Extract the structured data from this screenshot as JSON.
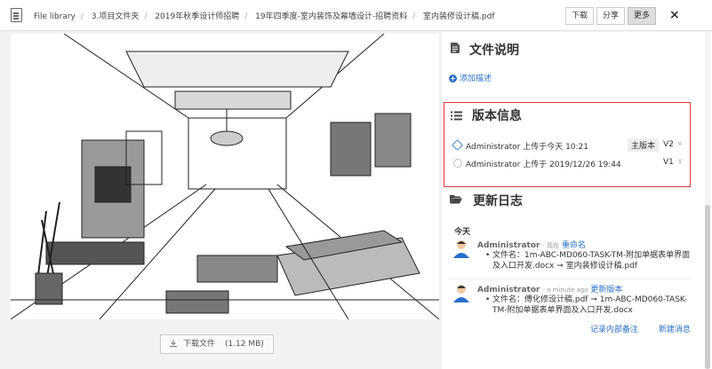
{
  "breadcrumbs": [
    "File library",
    "3.项目文件夹",
    "2019年秋季设计师招聘",
    "19年四季度-室内装饰及幕墙设计-招聘资料",
    "室内装修设计稿.pdf"
  ],
  "toolbar": {
    "download": "下载",
    "share": "分享",
    "more": "更多",
    "close": "×"
  },
  "viewer": {
    "download_label": "下载文件",
    "file_size": "(1.12 MB)"
  },
  "description": {
    "title": "文件说明",
    "add_link": "添加描述"
  },
  "versions": {
    "title": "版本信息",
    "items": [
      {
        "text": "Administrator 上传于今天 10:21",
        "badge": "主版本",
        "version": "V2"
      },
      {
        "text": "Administrator 上传于 2019/12/26 19:44",
        "badge": "",
        "version": "V1"
      }
    ]
  },
  "changelog": {
    "title": "更新日志",
    "day": "今天",
    "entries": [
      {
        "user": "Administrator",
        "time": "- 现在",
        "action": "重命名",
        "detail": "文件名：1m-ABC-MD060-TASK-TM-附加单据表单界面及入口开发.docx ➞ 室内装修设计稿.pdf"
      },
      {
        "user": "Administrator",
        "time": "- a minute ago",
        "action": "更新版本",
        "detail": "文件名：傅化修设计稿.pdf ➞ 1m-ABC-MD060-TASK-TM-附加单据表单界面及入口开发.docx"
      }
    ],
    "links": [
      "记录内部备注",
      "新建消息"
    ]
  },
  "colors": {
    "accent": "#2a6fc9",
    "highlight_border": "#e03636"
  }
}
